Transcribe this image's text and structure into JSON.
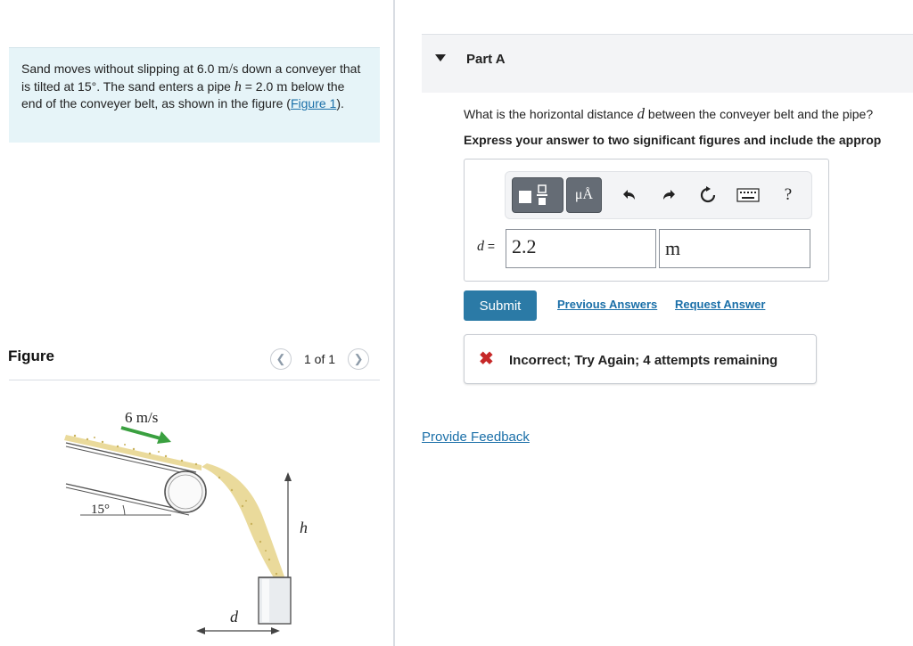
{
  "problem": {
    "segments": [
      {
        "t": "Sand moves without slipping at 6.0 ",
        "s": "text"
      },
      {
        "t": "m/s",
        "s": "math"
      },
      {
        "t": " down a conveyer that is tilted at 15°. The sand enters a pipe ",
        "s": "text"
      },
      {
        "t": "h",
        "s": "mathvar"
      },
      {
        "t": " = 2.0 ",
        "s": "text"
      },
      {
        "t": "m",
        "s": "math"
      },
      {
        "t": " below the end of the conveyer belt, as shown in the figure (",
        "s": "text"
      }
    ],
    "figure_link": "Figure 1",
    "tail": ")."
  },
  "figure": {
    "heading": "Figure",
    "pager_text": "1 of 1",
    "prev_icon": "chevron-left-icon",
    "next_icon": "chevron-right-icon",
    "labels": {
      "speed": "6 m/s",
      "angle": "15°",
      "height": "h",
      "distance": "d"
    }
  },
  "part": {
    "title": "Part A",
    "question_pre": "What is the horizontal distance ",
    "question_var": "d",
    "question_post": " between the conveyer belt and the pipe?",
    "instruction": "Express your answer to two significant figures and include the approp"
  },
  "toolbar": {
    "units_label": "μÅ",
    "help_label": "?",
    "icons": [
      "templates-icon",
      "units-icon",
      "undo-icon",
      "redo-icon",
      "reset-icon",
      "keyboard-icon",
      "help-icon"
    ]
  },
  "answer": {
    "var": "d",
    "eq": " =",
    "value": "2.2",
    "unit": "m"
  },
  "actions": {
    "submit": "Submit",
    "previous_answers": "Previous Answers",
    "request_answer": "Request Answer"
  },
  "feedback": {
    "icon": "x-icon",
    "text": "Incorrect; Try Again; 4 attempts remaining"
  },
  "provide_feedback": "Provide Feedback",
  "colors": {
    "problem_bg": "#e6f4f8",
    "link": "#1a6fa8",
    "submit_bg": "#2b7aa6",
    "error": "#c62828",
    "arrow_green": "#3aa040",
    "sand": "#e6d48a"
  }
}
